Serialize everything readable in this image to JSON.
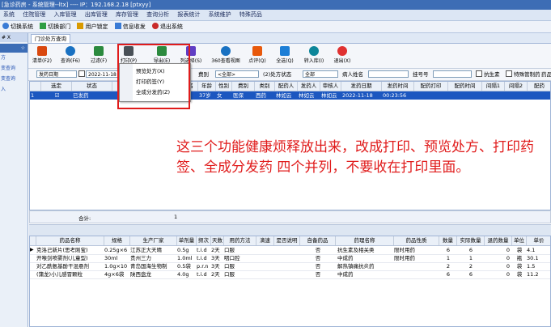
{
  "window": {
    "title": "[急诊药房 - 系统管理--ltx] ---- IP：192.168.2.18 [ptxyy]"
  },
  "menu": [
    "系统",
    "住院管理",
    "入库管理",
    "出库管理",
    "库存管理",
    "查询分析",
    "报表统计",
    "系统维护",
    "特殊药品"
  ],
  "quickbar": [
    {
      "label": "切换系统",
      "icon": "switch-system-icon",
      "color": "#3a7bd5"
    },
    {
      "label": "切换部门",
      "icon": "switch-dept-icon",
      "color": "#2f9e44"
    },
    {
      "label": "用户锁定",
      "icon": "lock-icon",
      "color": "#d99a00"
    },
    {
      "label": "信息收发",
      "icon": "message-icon",
      "color": "#3a7bd5"
    },
    {
      "label": "退出系统",
      "icon": "exit-icon",
      "color": "#c92a2a"
    }
  ],
  "left_panel": {
    "header": "# X",
    "tab": "☆",
    "items": [
      "方",
      "变查询",
      "变查询",
      "入"
    ]
  },
  "tab": {
    "label": "门诊处方查询"
  },
  "toolbar": [
    {
      "label": "清单(F2)",
      "icon": "clear-icon",
      "color": "#d9480f"
    },
    {
      "label": "查询(F6)",
      "icon": "search-icon",
      "color": "#1971c2"
    },
    {
      "label": "过滤(F)",
      "icon": "filter-icon",
      "color": "#2b8a3e"
    },
    {
      "label": "打印(P)",
      "icon": "print-icon",
      "color": "#495057"
    },
    {
      "label": "导出(E)",
      "icon": "export-icon",
      "color": "#2b8a3e"
    },
    {
      "label": "列选择(S)",
      "icon": "columns-icon",
      "color": "#5f3dc4"
    },
    {
      "label": "360查看视图",
      "icon": "view-360-icon",
      "color": "#1971c2"
    },
    {
      "label": "点评(Q)",
      "icon": "review-icon",
      "color": "#e8590c"
    },
    {
      "label": "全选(Q)",
      "icon": "select-all-icon",
      "color": "#1c7ed6"
    },
    {
      "label": "转入库(I)",
      "icon": "transfer-icon",
      "color": "#0c8599"
    },
    {
      "label": "退出(X)",
      "icon": "exit-icon",
      "color": "#e03131"
    }
  ],
  "print_menu": [
    "预览处方(X)",
    "打印药签(Y)",
    "全成分发药(Z)"
  ],
  "filters": {
    "date_type": "发药日期",
    "date_from": "2022-11-18",
    "category_label": "费别",
    "category_value": "<全部>",
    "status_label": "(2)处方状态",
    "status_value": "全部",
    "patient_label": "病人姓名",
    "bed_label": "挂号号",
    "antibiotic_label": "抗生素",
    "special_label": "特殊管制药",
    "drug_label": "药品"
  },
  "grid1": {
    "headers": [
      "",
      "选定",
      "状态",
      "处方",
      "姓名",
      "年龄",
      "性别",
      "费别",
      "类别",
      "配药人",
      "发药人",
      "审核人",
      "发药日期",
      "发药时间",
      "配药打印",
      "配药时间",
      "间隔1",
      "间隔2",
      "配药"
    ],
    "row": [
      "1",
      "☑",
      "已发药",
      "",
      "",
      "37岁",
      "女",
      "医保",
      "西药",
      "林如云",
      "林如云",
      "林如云",
      "2022-11-18",
      "00:23:56",
      "",
      "",
      "",
      "",
      ""
    ]
  },
  "summary": {
    "label": "合计:",
    "value": "1"
  },
  "grid2": {
    "headers": [
      "药品名称",
      "规格",
      "生产厂家",
      "单剂量",
      "频次",
      "天数",
      "用药方法",
      "滴速",
      "是否说明",
      "自备药品",
      "药理名称",
      "药品性质",
      "数量",
      "实际数量",
      "退药数量",
      "单位",
      "单价"
    ],
    "rows": [
      [
        "克洛己新片(思考刚宝)",
        "0.25g×6",
        "江苏正大天晴",
        "0.5g",
        "t.i.d",
        "2天",
        "口服",
        "",
        "",
        "否",
        "抗生素及相关类",
        "限时用药",
        "6",
        "6",
        "0",
        "袋",
        "4.1"
      ],
      [
        "开喉剑喷雾剂(儿童型)",
        "30ml",
        "贵州三力",
        "1.0ml",
        "t.i.d",
        "3天",
        "咽口腔",
        "",
        "",
        "否",
        "中成药",
        "限时用药",
        "1",
        "1",
        "0",
        "瓶",
        "30.1"
      ],
      [
        "对乙酰氨基酚干混悬剂",
        "1.0g×10",
        "青岛国海生物制",
        "0.5袋",
        "p.r.n",
        "3天",
        "口服",
        "",
        "",
        "否",
        "解热镇痛抗炎药",
        "",
        "2",
        "2",
        "0",
        "袋",
        "1.5"
      ],
      [
        "(蒲龙)小儿感冒颗粒",
        "4g×6袋",
        "陕西盘龙",
        "4.0g",
        "t.i.d",
        "2天",
        "口服",
        "",
        "",
        "否",
        "中成药",
        "",
        "6",
        "6",
        "0",
        "袋",
        "11.2"
      ]
    ]
  },
  "annotation": "这三个功能健康烦释放出来，改成打印、预览处方、打印药签、全成分发药 四个并列，不要收在打印里面。",
  "colors": {
    "title_bar": "#3d6db5",
    "selected_row": "#1c57c0",
    "annotation": "#e01b1b"
  }
}
